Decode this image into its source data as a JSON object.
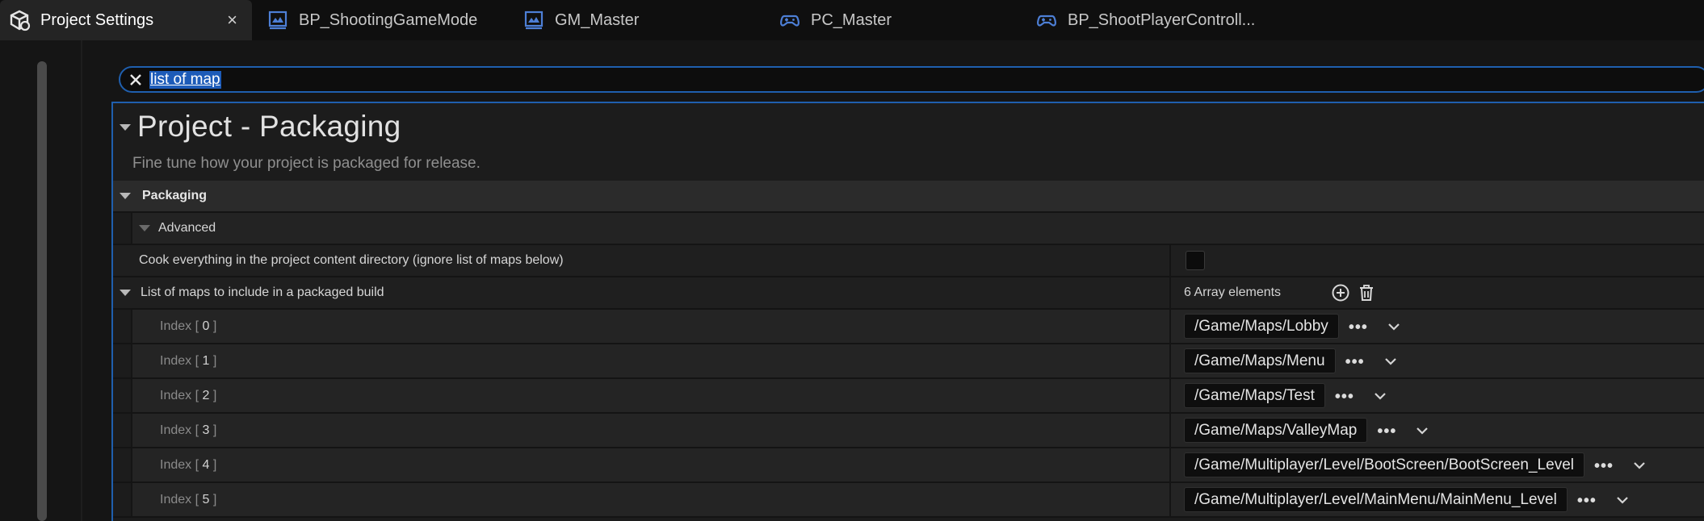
{
  "tabs": [
    {
      "label": "Project Settings",
      "icon": "settings-cube-icon",
      "active": true,
      "close": "×"
    },
    {
      "label": "BP_ShootingGameMode",
      "icon": "blueprint-gamemode-icon"
    },
    {
      "label": "GM_Master",
      "icon": "blueprint-gamemode-icon"
    },
    {
      "label": "PC_Master",
      "icon": "gamepad-icon"
    },
    {
      "label": "BP_ShootPlayerControll...",
      "icon": "gamepad-icon"
    }
  ],
  "search": {
    "query": "list of map",
    "clear_icon": "close-icon"
  },
  "section": {
    "title": "Project - Packaging",
    "description": "Fine tune how your project is packaged for release."
  },
  "category": {
    "label": "Packaging"
  },
  "advanced": {
    "label": "Advanced"
  },
  "cook_everything": {
    "label": "Cook everything in the project content directory (ignore list of maps below)",
    "checked": false
  },
  "maps_list": {
    "label": "List of maps to include in a packaged build",
    "count_text": "6 Array elements",
    "add_icon": "add-circle-icon",
    "delete_icon": "trash-icon",
    "items": [
      {
        "index_prefix": "Index [",
        "index": "0",
        "index_suffix": "]",
        "path": "/Game/Maps/Lobby"
      },
      {
        "index_prefix": "Index [",
        "index": "1",
        "index_suffix": "]",
        "path": "/Game/Maps/Menu"
      },
      {
        "index_prefix": "Index [",
        "index": "2",
        "index_suffix": "]",
        "path": "/Game/Maps/Test"
      },
      {
        "index_prefix": "Index [",
        "index": "3",
        "index_suffix": "]",
        "path": "/Game/Maps/ValleyMap"
      },
      {
        "index_prefix": "Index [",
        "index": "4",
        "index_suffix": "]",
        "path": "/Game/Multiplayer/Level/BootScreen/BootScreen_Level"
      },
      {
        "index_prefix": "Index [",
        "index": "5",
        "index_suffix": "]",
        "path": "/Game/Multiplayer/Level/MainMenu/MainMenu_Level"
      }
    ],
    "browse_label": "•••",
    "dropdown_icon": "chevron-down-icon"
  },
  "colors": {
    "accent": "#1f5fae",
    "selection": "#1d5bb8",
    "background": "#151515"
  }
}
